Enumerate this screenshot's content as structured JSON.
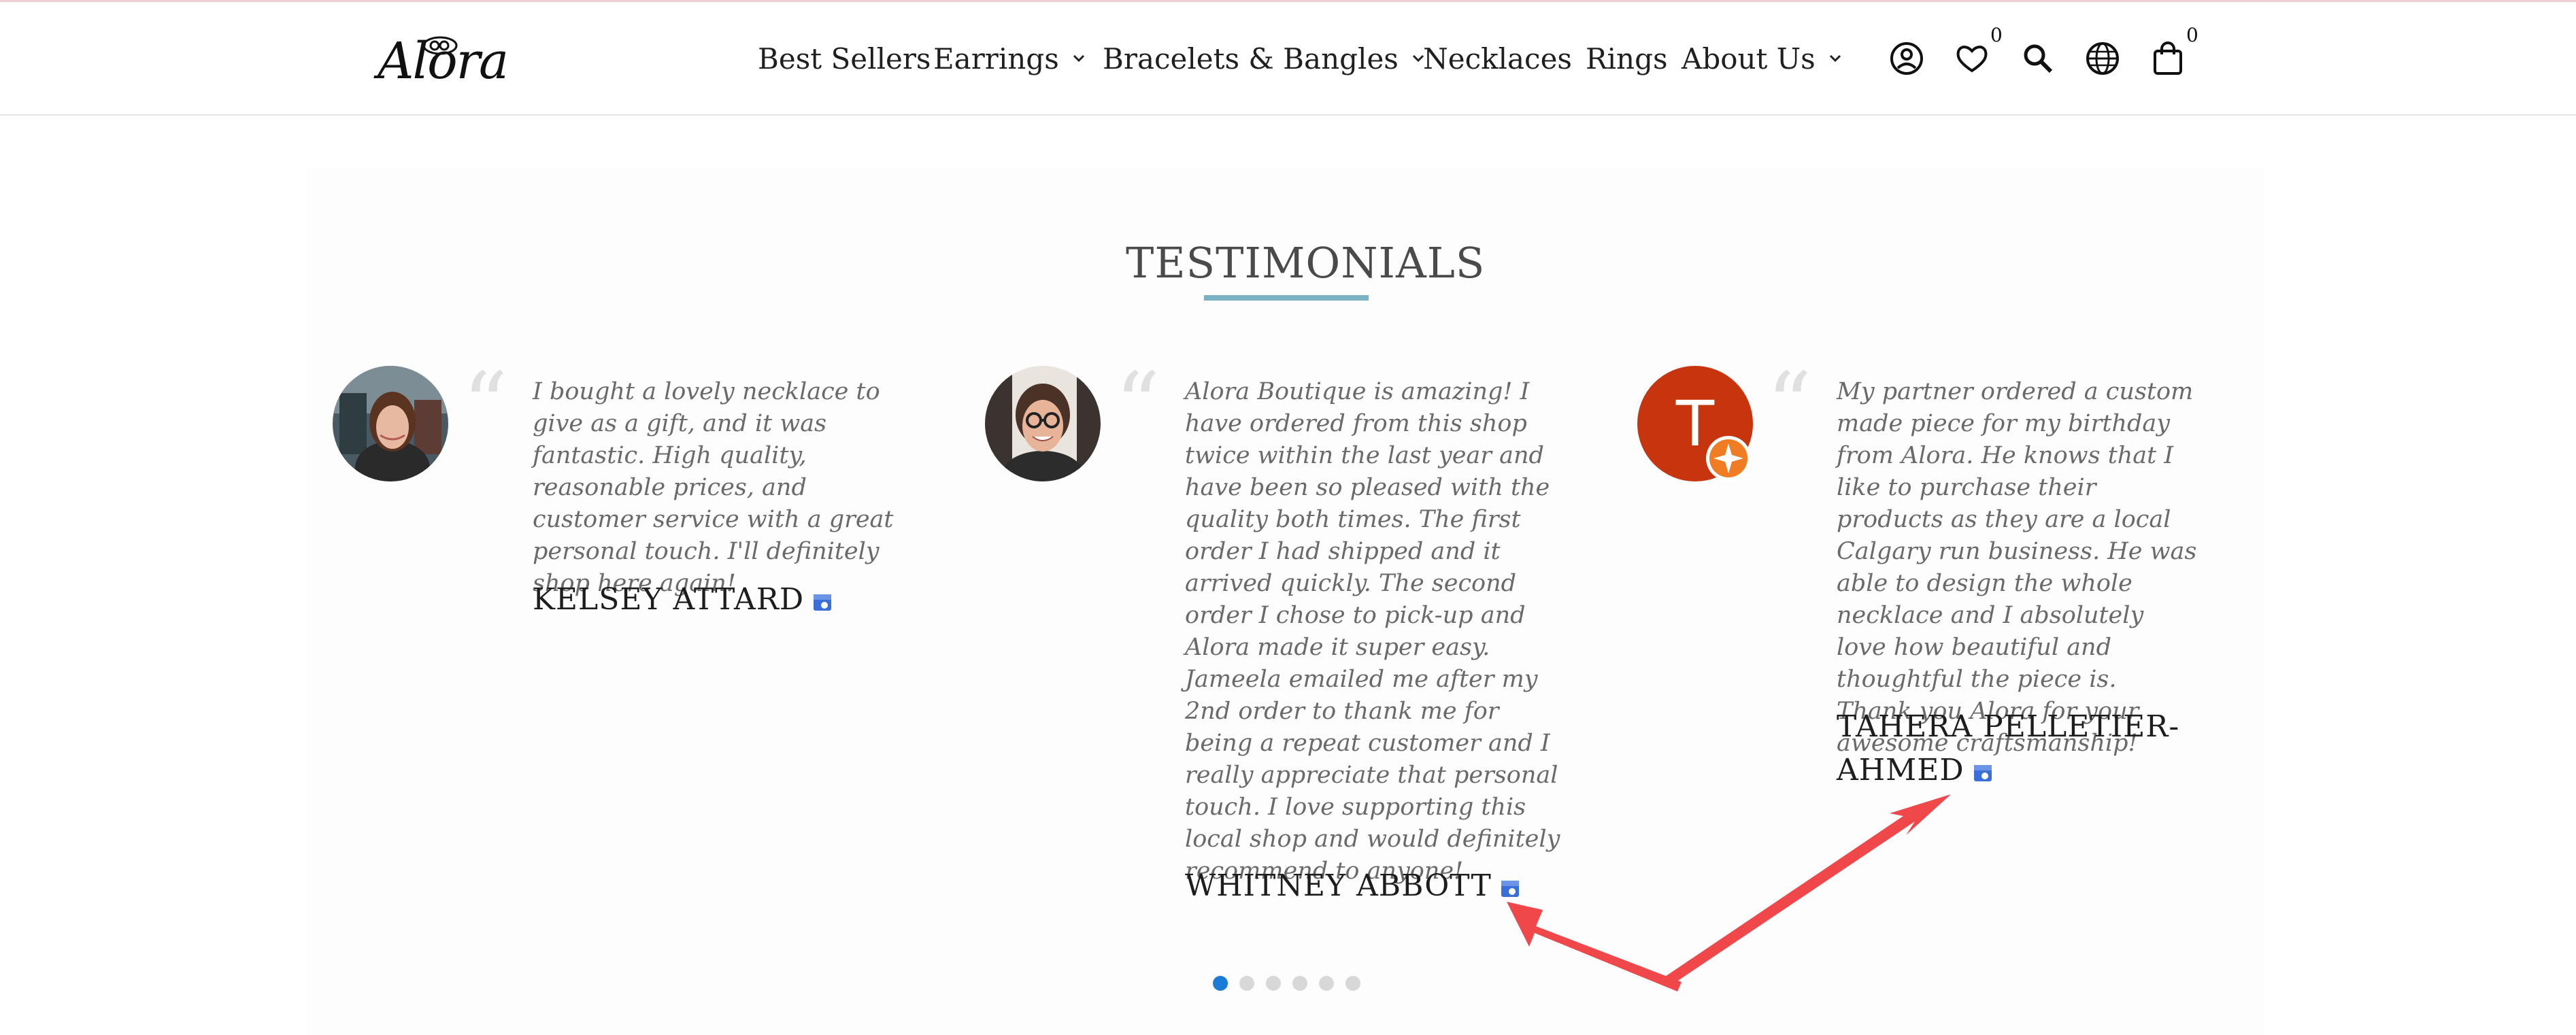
{
  "brand": {
    "logo_text": "Alora"
  },
  "nav": {
    "items": [
      {
        "label": "Best Sellers"
      },
      {
        "label": "Earrings"
      },
      {
        "label": "Bracelets & Bangles"
      },
      {
        "label": "Necklaces"
      },
      {
        "label": "Rings"
      },
      {
        "label": "About Us"
      }
    ]
  },
  "header_icons": {
    "account": "account-icon",
    "wishlist": "heart-icon",
    "wishlist_count": "0",
    "search": "search-icon",
    "language": "globe-icon",
    "cart": "cart-icon",
    "cart_count": "0"
  },
  "testimonials": {
    "title": "TESTIMONIALS",
    "items": [
      {
        "quote": "I bought a lovely necklace to give as a gift, and it was fantastic. High quality, reasonable prices, and customer service with a great personal touch. I'll definitely shop here again!",
        "author": "KELSEY ATTARD"
      },
      {
        "quote": "Alora Boutique is amazing! I have ordered from this shop twice within the last year and have been so pleased with the quality both times. The first order I had shipped and it arrived quickly. The second order I chose to pick-up and Alora made it super easy. Jameela emailed me after my 2nd order to thank me for being a repeat customer and I really appreciate that personal touch. I love supporting this local shop and would definitely recommend to anyone!",
        "author": "WHITNEY ABBOTT"
      },
      {
        "quote": "My partner ordered a custom made piece for my birthday from Alora. He knows that I like to purchase their products as they are a local Calgary run business. He was able to design the whole necklace and I absolutely love how beautiful and thoughtful the piece is. Thank you Alora for your awesome craftsmanship!",
        "author": "TAHERA PELLETIER-AHMED",
        "avatar_letter": "T"
      }
    ],
    "pagination": {
      "count": 6,
      "active": 1
    }
  },
  "colors": {
    "accent_underline": "#7bb3c4",
    "active_dot": "#1a7bd9",
    "annotation_arrow": "#f0474a",
    "avatar_t_bg": "#c7350f"
  }
}
